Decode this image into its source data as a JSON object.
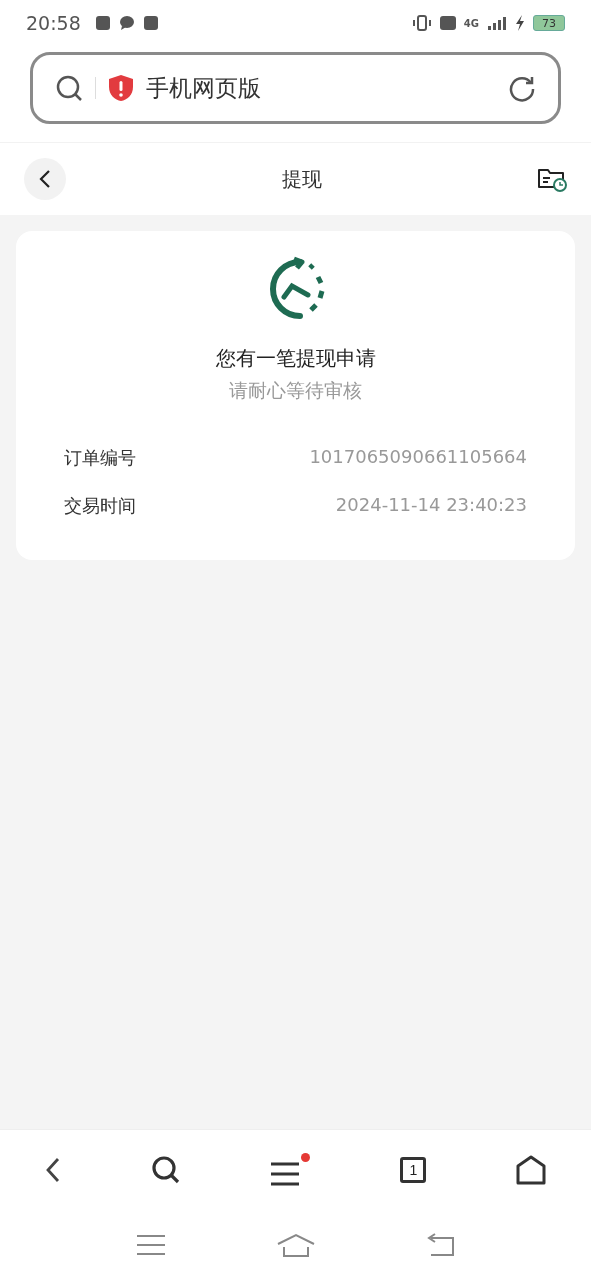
{
  "status_bar": {
    "time": "20:58",
    "network": "4G",
    "battery": "73"
  },
  "address_bar": {
    "title": "手机网页版"
  },
  "header": {
    "title": "提现"
  },
  "card": {
    "title": "您有一笔提现申请",
    "subtitle": "请耐心等待审核",
    "rows": [
      {
        "label": "订单编号",
        "value": "1017065090661105664"
      },
      {
        "label": "交易时间",
        "value": "2024-11-14 23:40:23"
      }
    ]
  },
  "toolbar": {
    "tab_count": "1",
    "menu_badge": true
  }
}
